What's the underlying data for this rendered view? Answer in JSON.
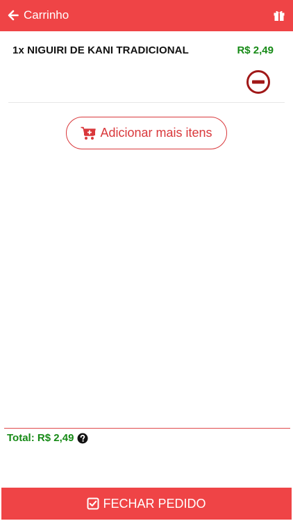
{
  "header": {
    "title": "Carrinho",
    "back_icon": "arrow-left-icon",
    "gift_icon": "gift-icon",
    "bg_color": "#ef4446"
  },
  "cart": {
    "items": [
      {
        "name": "1x NIGUIRI DE KANI TRADICIONAL",
        "price": "R$ 2,49",
        "remove_icon": "minus-circle-icon"
      }
    ]
  },
  "actions": {
    "add_more_label": "Adicionar mais itens",
    "add_more_icon": "cart-plus-icon"
  },
  "summary": {
    "total_label": "Total: R$ 2,49",
    "help_icon": "question-circle-icon"
  },
  "footer": {
    "checkout_label": "FECHAR PEDIDO",
    "checkout_icon": "check-square-icon"
  },
  "colors": {
    "accent": "#ef4446",
    "price_green": "#168a16",
    "remove_red": "#a01818"
  }
}
